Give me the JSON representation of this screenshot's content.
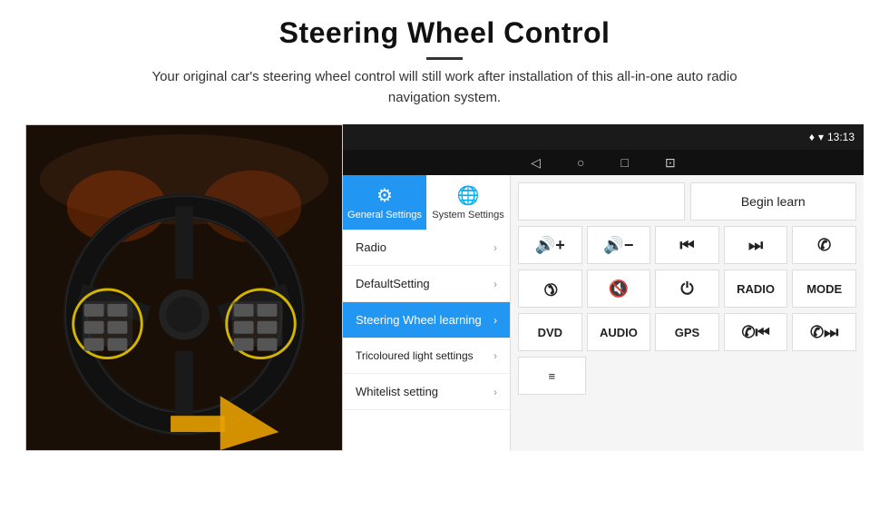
{
  "header": {
    "title": "Steering Wheel Control",
    "description": "Your original car's steering wheel control will still work after installation of this all-in-one auto radio navigation system."
  },
  "statusbar": {
    "time": "13:13"
  },
  "tabs": [
    {
      "id": "general",
      "label": "General Settings",
      "active": true
    },
    {
      "id": "system",
      "label": "System Settings",
      "active": false
    }
  ],
  "menu": {
    "items": [
      {
        "label": "Radio",
        "active": false
      },
      {
        "label": "DefaultSetting",
        "active": false
      },
      {
        "label": "Steering Wheel learning",
        "active": true
      },
      {
        "label": "Tricoloured light settings",
        "active": false
      },
      {
        "label": "Whitelist setting",
        "active": false
      }
    ]
  },
  "control_panel": {
    "begin_learn_label": "Begin learn",
    "row1": [
      {
        "label": "🔊+",
        "name": "vol-up"
      },
      {
        "label": "🔊−",
        "name": "vol-down"
      },
      {
        "label": "⏮",
        "name": "prev"
      },
      {
        "label": "⏭",
        "name": "next"
      },
      {
        "label": "📞",
        "name": "call"
      }
    ],
    "row2": [
      {
        "label": "↩",
        "name": "hang-up"
      },
      {
        "label": "🔇",
        "name": "mute"
      },
      {
        "label": "⏻",
        "name": "power"
      },
      {
        "label": "RADIO",
        "name": "radio"
      },
      {
        "label": "MODE",
        "name": "mode"
      }
    ],
    "row3": [
      {
        "label": "DVD",
        "name": "dvd"
      },
      {
        "label": "AUDIO",
        "name": "audio"
      },
      {
        "label": "GPS",
        "name": "gps"
      },
      {
        "label": "📞⏮",
        "name": "call-prev"
      },
      {
        "label": "📞⏭",
        "name": "call-next"
      }
    ],
    "row4": [
      {
        "label": "≡",
        "name": "menu-icon-row4"
      }
    ]
  },
  "icons": {
    "gear": "⚙",
    "globe": "🌐",
    "back": "◁",
    "home": "○",
    "square": "□",
    "screenshot": "⊡",
    "location": "♦",
    "wifi": "▾",
    "vol_up": "🔊+",
    "vol_down": "🔊−",
    "skip_prev": "⏮",
    "skip_next": "⏭",
    "phone": "✆",
    "hangup": "✆",
    "mute": "✕",
    "power": "⏻"
  }
}
